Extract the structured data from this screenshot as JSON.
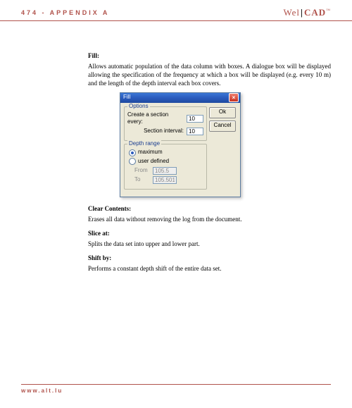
{
  "header": {
    "page_label": "474 - APPENDIX A",
    "brand_wel": "Wel",
    "brand_cad": "CAD",
    "brand_tm": "™"
  },
  "sections": {
    "fill": {
      "title": "Fill:",
      "body": "Allows automatic population of the data column with boxes. A dialogue box will be displayed allowing the specification of the frequency at which a box will be displayed (e.g. every 10 m) and the length of the depth interval each box covers."
    },
    "clear": {
      "title": "Clear Contents:",
      "body": "Erases all data without removing the log from the document."
    },
    "slice": {
      "title": "Slice at:",
      "body": "Splits the data set into upper and lower part."
    },
    "shift": {
      "title": "Shift by:",
      "body": "Performs a constant depth shift of the entire data set."
    }
  },
  "dialog": {
    "title": "Fill",
    "options_legend": "Options",
    "create_label": "Create a section every:",
    "create_value": "10",
    "interval_label": "Section interval:",
    "interval_value": "10",
    "range_legend": "Depth range",
    "radio_max": "maximum",
    "radio_user": "user defined",
    "from_label": "From",
    "from_value": "105.5",
    "to_label": "To",
    "to_value": "105.501",
    "ok": "Ok",
    "cancel": "Cancel"
  },
  "footer": {
    "url": "www.alt.lu"
  }
}
